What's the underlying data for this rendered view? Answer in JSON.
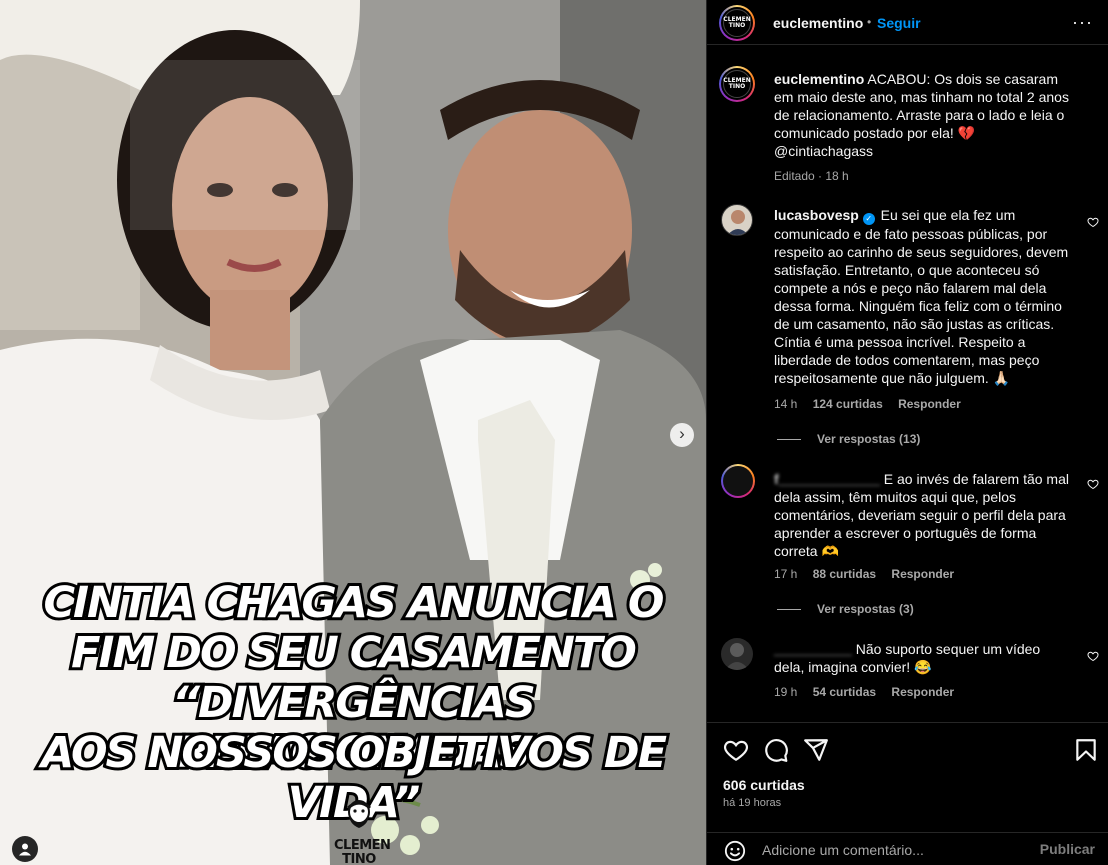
{
  "post": {
    "media": {
      "headline_lines": [
        "CINTIA CHAGAS ANUNCIA O",
        "FIM DO SEU CASAMENTO",
        "“DIVERGÊNCIAS RELACIONADAS",
        "AOS NOSSOS OBJETIVOS DE VIDA”"
      ],
      "watermark_text": "CLEMEN",
      "watermark_sub": "TINO",
      "next_glyph": "›"
    },
    "header": {
      "username": "euclementino",
      "separator": "•",
      "follow_label": "Seguir",
      "more_glyph": "···",
      "avatar_logo_top": "CLEMEN",
      "avatar_logo_bottom": "TINO"
    },
    "caption": {
      "username": "euclementino",
      "text": "ACABOU: Os dois se casaram em maio deste ano, mas tinham no total 2 anos de relacionamento. Arraste para o lado e leia o comunicado postado por ela! 💔 @cintiachagass",
      "meta": "Editado · 18 h"
    },
    "comments": [
      {
        "username": "lucasbovesp",
        "text": "Eu sei que ela fez um comunicado e de fato pessoas públicas, por respeito ao carinho de seus seguidores, devem satisfação. Entretanto, o que aconteceu só compete a nós e peço não falarem mal dela dessa forma. Ninguém fica feliz com o término de um casamento, não são justas as críticas. Cíntia é uma pessoa incrível. Respeito a liberdade de todos comentarem, mas peço respeitosamente que não julguem. 🙏🏻",
        "time": "14 h",
        "likes": "124 curtidas",
        "reply_label": "Responder",
        "replies": "Ver respostas (13)"
      },
      {
        "username": "f_____________",
        "text": "E ao invés de falarem tão mal dela assim, têm muitos aqui que, pelos comentários, deveriam seguir o perfil dela para aprender a escrever o português de forma correta 🫶",
        "time": "17 h",
        "likes": "88 curtidas",
        "reply_label": "Responder",
        "replies": "Ver respostas (3)"
      },
      {
        "username": "__________",
        "text": "Não suporto sequer um vídeo dela, imagina convier! 😂",
        "time": "19 h",
        "likes": "54 curtidas",
        "reply_label": "Responder"
      }
    ],
    "footer": {
      "likes": "606 curtidas",
      "time": "há 19 horas",
      "comment_placeholder": "Adicione um comentário...",
      "publish_label": "Publicar"
    }
  },
  "colors": {
    "background": "#000000",
    "accent": "#0095f6",
    "muted_text": "#a8a8a8",
    "divider": "#262626"
  },
  "icons": [
    "next-arrow-icon",
    "user-tag-icon",
    "more-options-icon",
    "verified-badge-icon",
    "heart-icon",
    "comment-icon",
    "share-icon",
    "bookmark-icon",
    "emoji-icon"
  ]
}
